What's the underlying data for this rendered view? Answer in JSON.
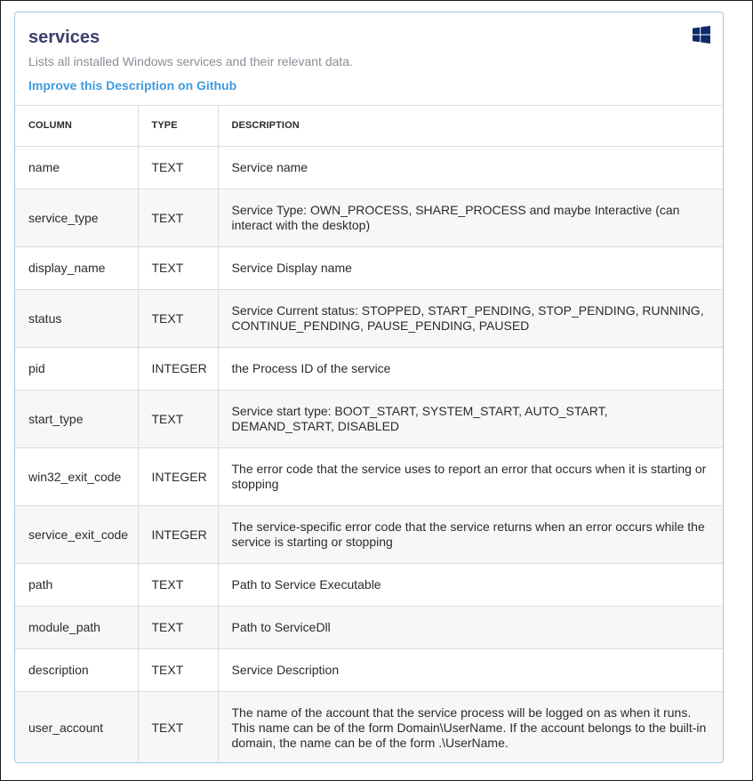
{
  "table": {
    "name": "services",
    "description": "Lists all installed Windows services and their relevant data.",
    "improve_link": "Improve this Description on Github",
    "platform_icon": "windows-icon",
    "accent_color": "#3d9be0",
    "title_color": "#3a3f6b"
  },
  "headers": {
    "column": "COLUMN",
    "type": "TYPE",
    "description": "DESCRIPTION"
  },
  "rows": [
    {
      "name": "name",
      "type": "TEXT",
      "description": "Service name"
    },
    {
      "name": "service_type",
      "type": "TEXT",
      "description": "Service Type: OWN_PROCESS, SHARE_PROCESS and maybe Interactive (can interact with the desktop)"
    },
    {
      "name": "display_name",
      "type": "TEXT",
      "description": "Service Display name"
    },
    {
      "name": "status",
      "type": "TEXT",
      "description": "Service Current status: STOPPED, START_PENDING, STOP_PENDING, RUNNING, CONTINUE_PENDING, PAUSE_PENDING, PAUSED"
    },
    {
      "name": "pid",
      "type": "INTEGER",
      "description": "the Process ID of the service"
    },
    {
      "name": "start_type",
      "type": "TEXT",
      "description": "Service start type: BOOT_START, SYSTEM_START, AUTO_START, DEMAND_START, DISABLED"
    },
    {
      "name": "win32_exit_code",
      "type": "INTEGER",
      "description": "The error code that the service uses to report an error that occurs when it is starting or stopping"
    },
    {
      "name": "service_exit_code",
      "type": "INTEGER",
      "description": "The service-specific error code that the service returns when an error occurs while the service is starting or stopping"
    },
    {
      "name": "path",
      "type": "TEXT",
      "description": "Path to Service Executable"
    },
    {
      "name": "module_path",
      "type": "TEXT",
      "description": "Path to ServiceDll"
    },
    {
      "name": "description",
      "type": "TEXT",
      "description": "Service Description"
    },
    {
      "name": "user_account",
      "type": "TEXT",
      "description": "The name of the account that the service process will be logged on as when it runs. This name can be of the form Domain\\UserName. If the account belongs to the built-in domain, the name can be of the form .\\UserName."
    }
  ]
}
